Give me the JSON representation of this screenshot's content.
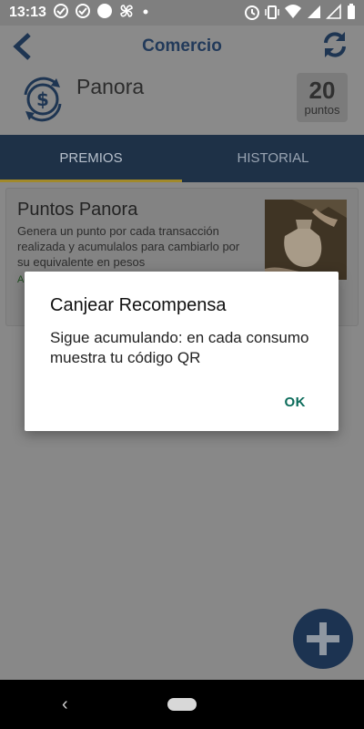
{
  "status_bar": {
    "time": "13:13",
    "left_icons": [
      "check-circle-icon",
      "check-circle-icon",
      "circle-icon",
      "pinwheel-icon",
      "dot-icon"
    ],
    "right_icons": [
      "alarm-icon",
      "vibrate-icon",
      "wifi-icon",
      "signal-icon",
      "signal-icon",
      "battery-icon"
    ]
  },
  "header": {
    "title": "Comercio",
    "merchant_name": "Panora",
    "points_value": "20",
    "points_label": "puntos",
    "accent_color": "#223a5a"
  },
  "tabs": [
    {
      "label": "PREMIOS",
      "active": true
    },
    {
      "label": "HISTORIAL",
      "active": false
    }
  ],
  "card": {
    "title": "Puntos Panora",
    "description": "Genera un punto por cada transacción realizada y acumulalos para cambiarlo por su equivalente en pesos",
    "link_text": "Ac"
  },
  "dialog": {
    "title": "Canjear Recompensa",
    "message": "Sigue acumulando: en cada consumo muestra tu código QR",
    "ok_label": "OK",
    "ok_color": "#0b6b5a"
  },
  "fab": {
    "icon": "plus-icon"
  },
  "nav_bar": {
    "back_icon": "‹",
    "home_icon": "home-pill-icon"
  }
}
